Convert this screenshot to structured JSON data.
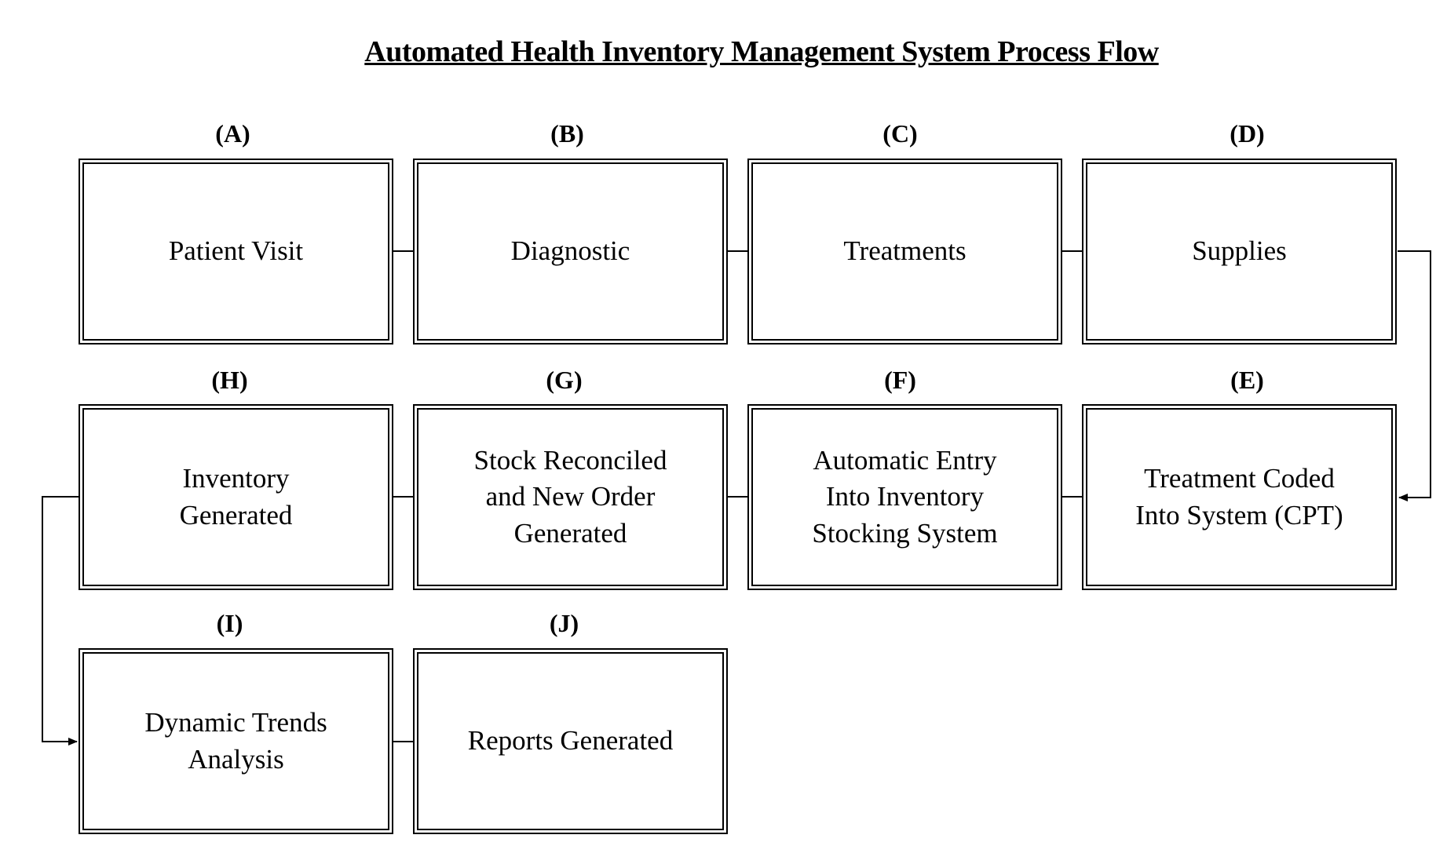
{
  "title": "Automated Health Inventory Management System Process Flow",
  "nodes": [
    {
      "id": "A",
      "letter": "(A)",
      "label": "Patient Visit"
    },
    {
      "id": "B",
      "letter": "(B)",
      "label": "Diagnostic"
    },
    {
      "id": "C",
      "letter": "(C)",
      "label": "Treatments"
    },
    {
      "id": "D",
      "letter": "(D)",
      "label": "Supplies"
    },
    {
      "id": "E",
      "letter": "(E)",
      "label": "Treatment Coded\nInto System (CPT)"
    },
    {
      "id": "F",
      "letter": "(F)",
      "label": "Automatic Entry\nInto Inventory\nStocking System"
    },
    {
      "id": "G",
      "letter": "(G)",
      "label": "Stock Reconciled\nand New Order\nGenerated"
    },
    {
      "id": "H",
      "letter": "(H)",
      "label": "Inventory\nGenerated"
    },
    {
      "id": "I",
      "letter": "(I)",
      "label": "Dynamic Trends\nAnalysis"
    },
    {
      "id": "J",
      "letter": "(J)",
      "label": "Reports Generated"
    }
  ],
  "edges": [
    {
      "from": "A",
      "to": "B"
    },
    {
      "from": "B",
      "to": "C"
    },
    {
      "from": "C",
      "to": "D"
    },
    {
      "from": "D",
      "to": "E",
      "arrow": true
    },
    {
      "from": "E",
      "to": "F"
    },
    {
      "from": "F",
      "to": "G"
    },
    {
      "from": "G",
      "to": "H"
    },
    {
      "from": "H",
      "to": "I",
      "arrow": true
    },
    {
      "from": "I",
      "to": "J"
    }
  ]
}
